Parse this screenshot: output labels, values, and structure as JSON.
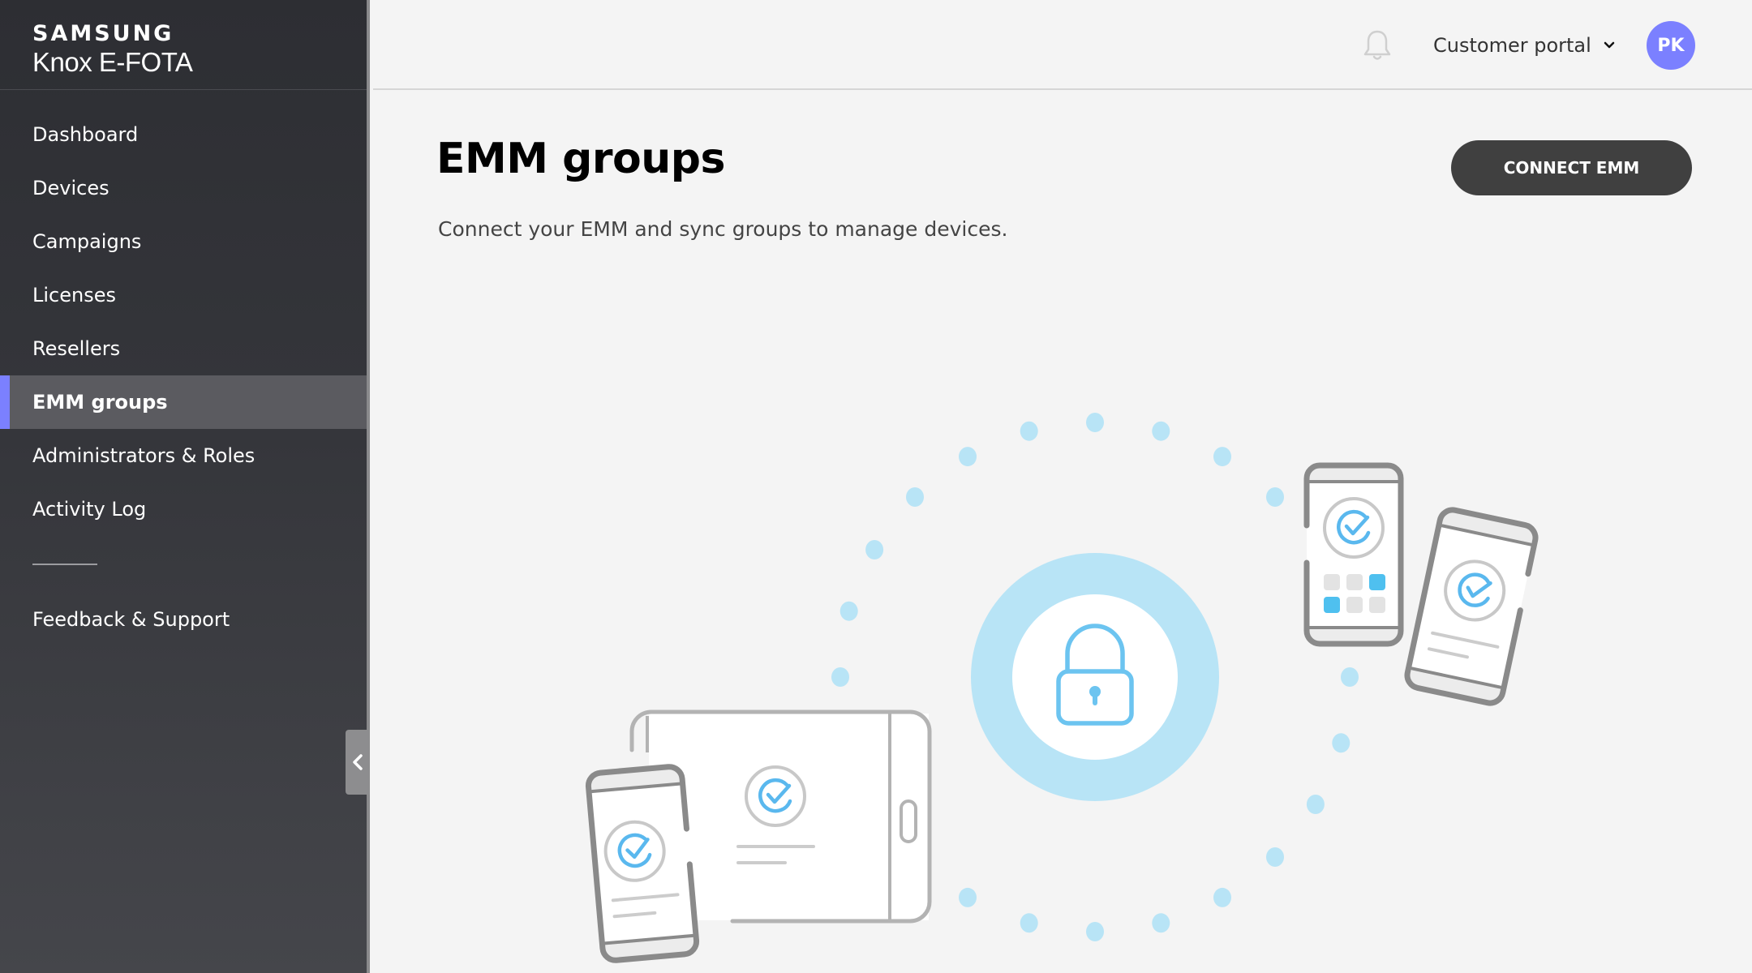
{
  "brand": {
    "company": "SAMSUNG",
    "product": "Knox E-FOTA"
  },
  "sidebar": {
    "items": [
      {
        "label": "Dashboard",
        "active": false
      },
      {
        "label": "Devices",
        "active": false
      },
      {
        "label": "Campaigns",
        "active": false
      },
      {
        "label": "Licenses",
        "active": false
      },
      {
        "label": "Resellers",
        "active": false
      },
      {
        "label": "EMM groups",
        "active": true
      },
      {
        "label": "Administrators & Roles",
        "active": false
      },
      {
        "label": "Activity Log",
        "active": false
      }
    ],
    "footer_items": [
      {
        "label": "Feedback & Support"
      }
    ],
    "collapse_icon": "chevron-left-icon"
  },
  "header": {
    "notification_icon": "bell-icon",
    "portal_selector": "Customer portal",
    "portal_icon": "chevron-down-icon",
    "avatar_initials": "PK"
  },
  "main": {
    "title": "EMM groups",
    "subtitle": "Connect your EMM and sync groups to manage devices.",
    "connect_button": "CONNECT EMM",
    "illustration": {
      "center_icon": "lock-icon",
      "devices": [
        "tablet",
        "phone",
        "phone",
        "phone"
      ],
      "device_icon": "check-circle-icon"
    }
  },
  "colors": {
    "sidebar_bg": "#2d2e33",
    "active_item_bg": "#5b5b60",
    "accent": "#7b80ff",
    "button_bg": "#404040",
    "illustration_blue": "#6cc4f0",
    "illustration_light_blue": "#b8e4f6",
    "page_bg": "#f4f4f4"
  }
}
